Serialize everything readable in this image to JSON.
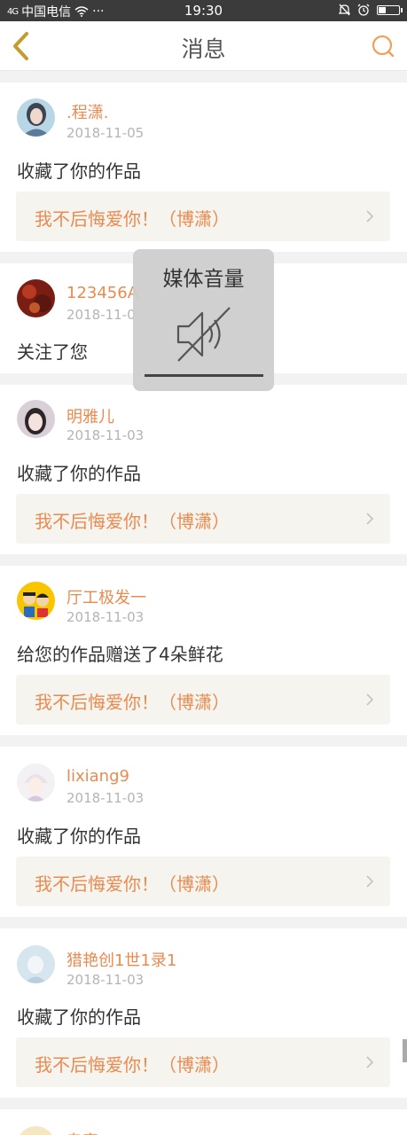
{
  "status_bar": {
    "signal": "4G",
    "carrier": "中国电信",
    "dots": "···",
    "time": "19:30"
  },
  "header": {
    "title": "消息"
  },
  "messages": [
    {
      "user": ".程潇.",
      "date": "2018-11-05",
      "action": "收藏了你的作品",
      "work_title": "我不后悔爱你！（博潇）"
    },
    {
      "user": "123456A",
      "date": "2018-11-0",
      "action": "关注了您"
    },
    {
      "user": "明雅儿",
      "date": "2018-11-03",
      "action": "收藏了你的作品",
      "work_title": "我不后悔爱你！（博潇）"
    },
    {
      "user": "厅工极发一",
      "date": "2018-11-03",
      "action": "给您的作品赠送了4朵鲜花",
      "work_title": "我不后悔爱你！（博潇）"
    },
    {
      "user": "lixiang9",
      "date": "2018-11-03",
      "action": "收藏了你的作品",
      "work_title": "我不后悔爱你！（博潇）"
    },
    {
      "user": "猎艳创1世1录1",
      "date": "2018-11-03",
      "action": "收藏了你的作品",
      "work_title": "我不后悔爱你！（博潇）"
    },
    {
      "user": "专家"
    }
  ],
  "volume_toast": {
    "title": "媒体音量",
    "level": 0,
    "muted": true
  },
  "colors": {
    "accent": "#e98b50",
    "status_bar": "#3b3b3b",
    "card_bg": "#ffffff",
    "page_bg": "#f2f2f2",
    "work_bg": "#f5f4ee"
  }
}
